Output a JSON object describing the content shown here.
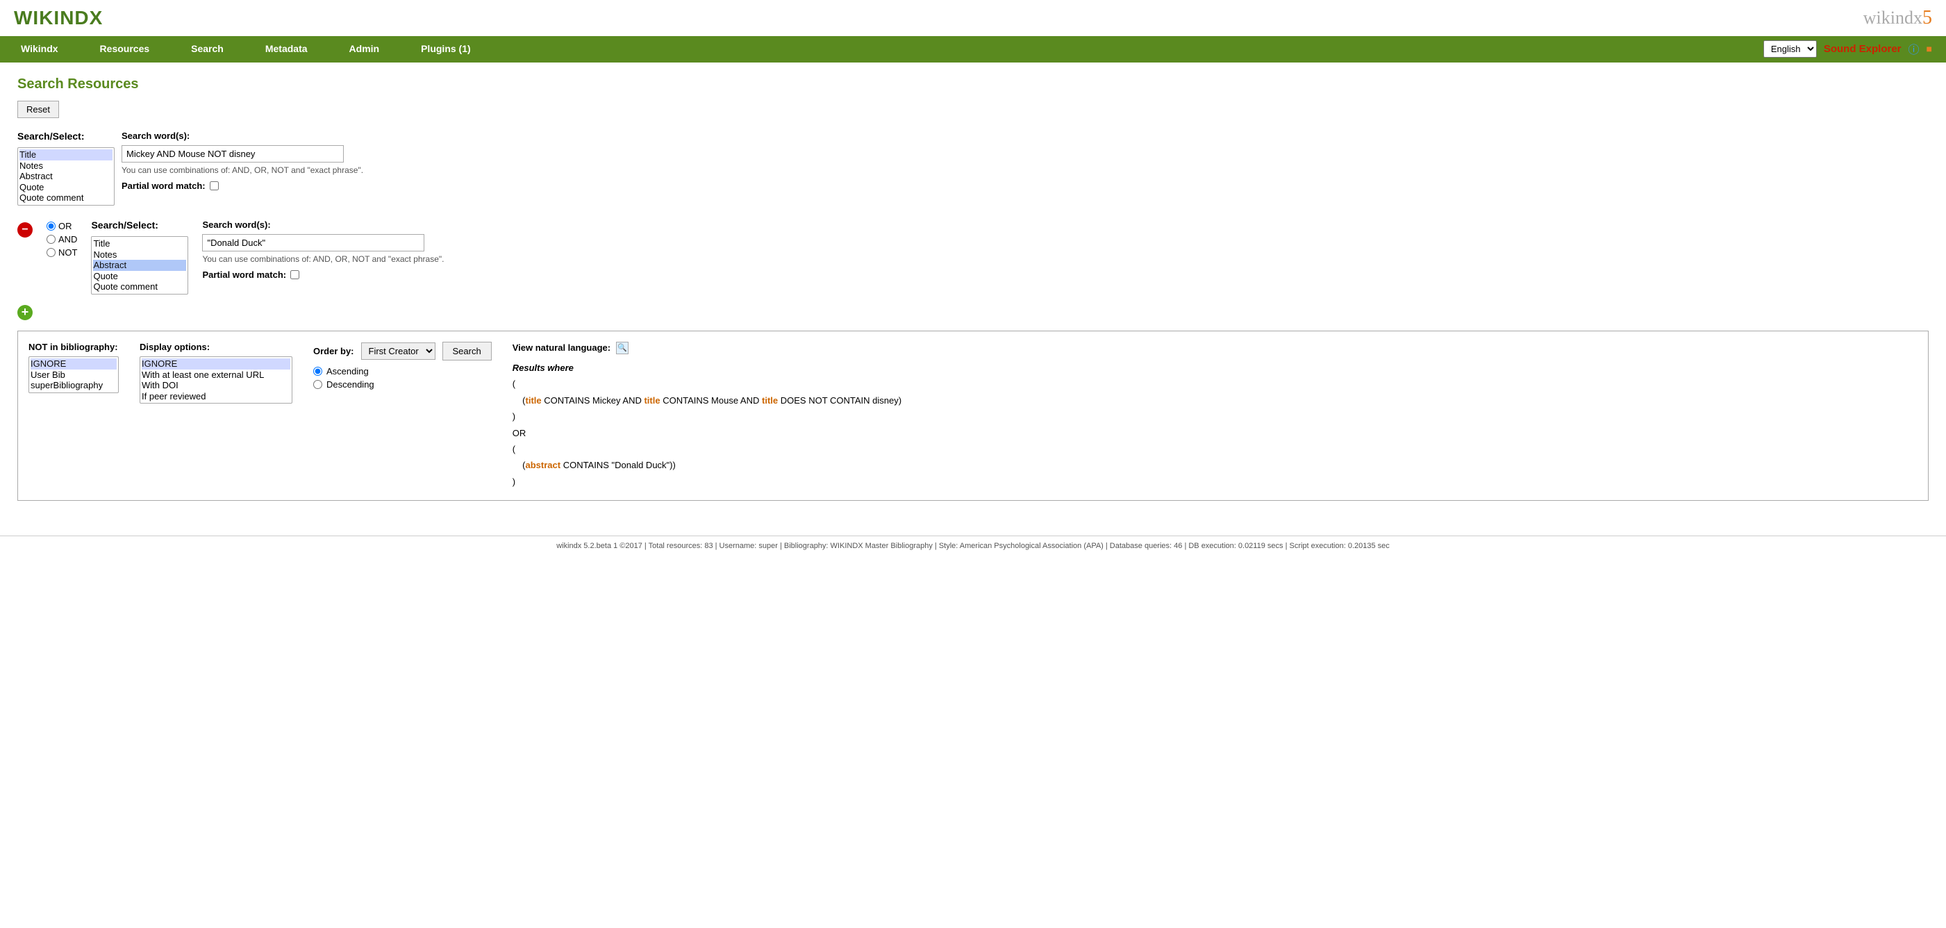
{
  "header": {
    "logo": "WIKINDX",
    "logo_right_wiki": "wikindx",
    "logo_right_five": "5",
    "lang_value": "English",
    "sound_explorer": "Sound Explorer",
    "help_icon": "?",
    "rss_icon": "⬛"
  },
  "nav": {
    "items": [
      "Wikindx",
      "Resources",
      "Search",
      "Metadata",
      "Admin",
      "Plugins (1)"
    ]
  },
  "page": {
    "title": "Search Resources",
    "reset_label": "Reset"
  },
  "search1": {
    "select_label": "Search/Select:",
    "options": [
      "Title",
      "Notes",
      "Abstract",
      "Quote",
      "Quote comment"
    ],
    "words_label": "Search word(s):",
    "words_value": "Mickey AND Mouse NOT disney",
    "hint": "You can use combinations of: AND, OR, NOT and \"exact phrase\".",
    "partial_label": "Partial word match:"
  },
  "search2": {
    "select_label": "Search/Select:",
    "options": [
      "Title",
      "Notes",
      "Abstract",
      "Quote",
      "Quote comment"
    ],
    "words_label": "Search word(s):",
    "words_value": "\"Donald Duck\"",
    "hint": "You can use combinations of: AND, OR, NOT and \"exact phrase\".",
    "partial_label": "Partial word match:",
    "operators": [
      "OR",
      "AND",
      "NOT"
    ]
  },
  "bottom": {
    "not_bib_label": "NOT in bibliography:",
    "not_bib_options": [
      "IGNORE",
      "User Bib",
      "superBibliography"
    ],
    "display_label": "Display options:",
    "display_options": [
      "IGNORE",
      "With at least one external URL",
      "With DOI",
      "If peer reviewed"
    ],
    "order_label": "Order by:",
    "order_option": "First Creator",
    "search_btn": "Search",
    "ascending_label": "Ascending",
    "descending_label": "Descending",
    "natural_lang_label": "View natural language:",
    "results_italic": "Results where",
    "results_line1": "(",
    "results_line2_pre": "    (",
    "results_line2_title1": "title",
    "results_line2_mid1": " CONTAINS Mickey AND ",
    "results_line2_title2": "title",
    "results_line2_mid2": " CONTAINS Mouse AND ",
    "results_line2_title3": "title",
    "results_line2_end": " DOES NOT CONTAIN disney)",
    "results_line3": ")",
    "results_line4": "OR",
    "results_line5": "(",
    "results_line6_pre": "    (",
    "results_line6_abstract": "abstract",
    "results_line6_end": " CONTAINS \"Donald Duck\"))",
    "results_line7": ")"
  },
  "footer": {
    "text": "wikindx 5.2.beta 1 ©2017 | Total resources: 83 | Username: super | Bibliography: WIKINDX Master Bibliography | Style: American Psychological Association (APA) | Database queries: 46 | DB execution: 0.02119 secs | Script execution: 0.20135 sec"
  }
}
